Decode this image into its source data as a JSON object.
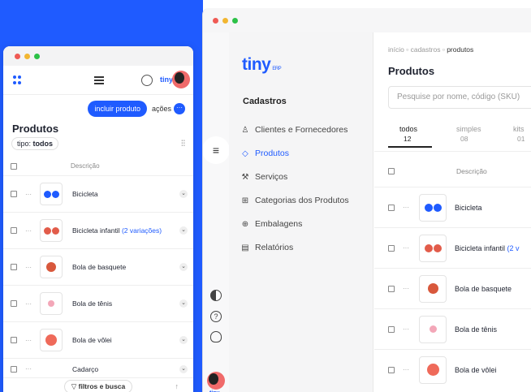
{
  "mobile": {
    "brand": "tiny",
    "buttons": {
      "incluir": "incluir produto",
      "acoes": "ações",
      "acoes_dots": "···"
    },
    "title": "Produtos",
    "filter": {
      "label": "tipo:",
      "value": "todos"
    },
    "column_descricao": "Descrição",
    "products": [
      {
        "name": "Bicicleta",
        "variations": ""
      },
      {
        "name": "Bicicleta infantil",
        "variations": "(2 variações)"
      },
      {
        "name": "Bola de basquete",
        "variations": ""
      },
      {
        "name": "Bola de tênis",
        "variations": ""
      },
      {
        "name": "Bola de vôlei",
        "variations": ""
      },
      {
        "name": "Cadarço",
        "variations": ""
      }
    ],
    "footer": {
      "filtros": "filtros e busca"
    }
  },
  "desktop": {
    "logo": "tiny",
    "logo_suffix": "ERP",
    "rail_brand": "tiny",
    "sidebar": {
      "section": "Cadastros",
      "items": [
        {
          "label": "Clientes e Fornecedores",
          "icon": "person-icon"
        },
        {
          "label": "Produtos",
          "icon": "tag-icon",
          "active": true
        },
        {
          "label": "Serviços",
          "icon": "wrench-icon"
        },
        {
          "label": "Categorias dos Produtos",
          "icon": "hierarchy-icon"
        },
        {
          "label": "Embalagens",
          "icon": "box-icon"
        },
        {
          "label": "Relatórios",
          "icon": "document-icon"
        }
      ]
    },
    "breadcrumb": {
      "inicio": "início",
      "cadastros": "cadastros",
      "current": "produtos"
    },
    "title": "Produtos",
    "search_placeholder": "Pesquise por nome, código (SKU)",
    "tabs": [
      {
        "label": "todos",
        "count": "12"
      },
      {
        "label": "simples",
        "count": "08"
      },
      {
        "label": "kits",
        "count": "01"
      }
    ],
    "column_descricao": "Descrição",
    "products": [
      {
        "name": "Bicicleta",
        "variations": ""
      },
      {
        "name": "Bicicleta infantil",
        "variations": "(2 v"
      },
      {
        "name": "Bola de basquete",
        "variations": ""
      },
      {
        "name": "Bola de tênis",
        "variations": ""
      },
      {
        "name": "Bola de vôlei",
        "variations": ""
      }
    ]
  },
  "colors": {
    "accent": "#1f5bff",
    "ball_red": "#e25c4a",
    "ball_blue": "#1f5bff",
    "ball_pink": "#f3a7b8"
  }
}
